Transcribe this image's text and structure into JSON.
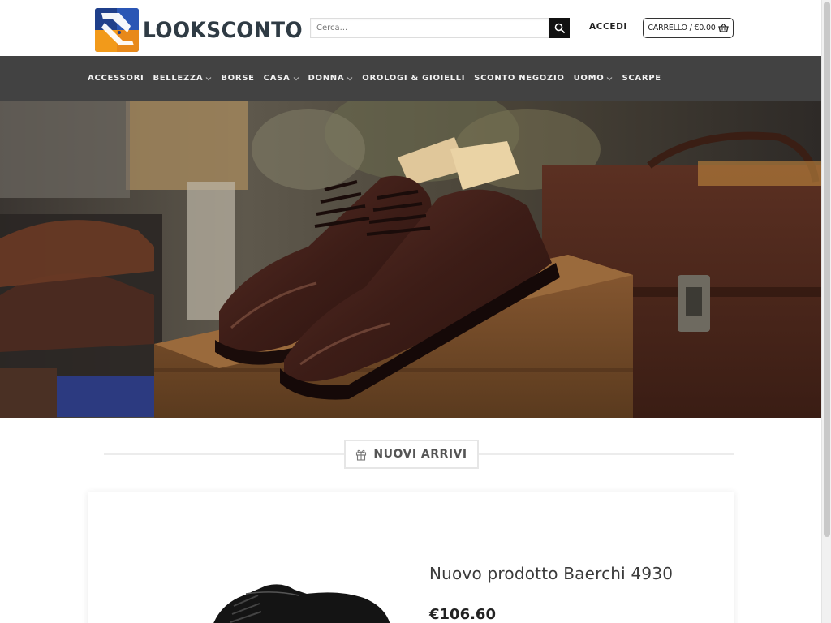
{
  "brand": {
    "name": "LOOKSCONTO",
    "colors": {
      "navy": "#1f3f8a",
      "orange": "#f29a1a",
      "text": "#2f3b44"
    }
  },
  "header": {
    "search_placeholder": "Cerca...",
    "login_label": "ACCEDI",
    "cart_label": "CARRELLO / €0.00",
    "search_icon": "search-icon",
    "cart_icon": "basket-icon"
  },
  "nav": {
    "items": [
      {
        "label": "ACCESSORI",
        "has_dropdown": false
      },
      {
        "label": "BELLEZZA",
        "has_dropdown": true
      },
      {
        "label": "BORSE",
        "has_dropdown": false
      },
      {
        "label": "CASA",
        "has_dropdown": true
      },
      {
        "label": "DONNA",
        "has_dropdown": true
      },
      {
        "label": "OROLOGI & GIOIELLI",
        "has_dropdown": false
      },
      {
        "label": "SCONTO NEGOZIO",
        "has_dropdown": false
      },
      {
        "label": "UOMO",
        "has_dropdown": true
      },
      {
        "label": "SCARPE",
        "has_dropdown": false
      }
    ],
    "background": "#424242"
  },
  "section": {
    "title": "NUOVI ARRIVI",
    "icon": "gift-icon"
  },
  "product": {
    "title": "Nuovo prodotto Baerchi 4930",
    "price": "€106.60"
  }
}
